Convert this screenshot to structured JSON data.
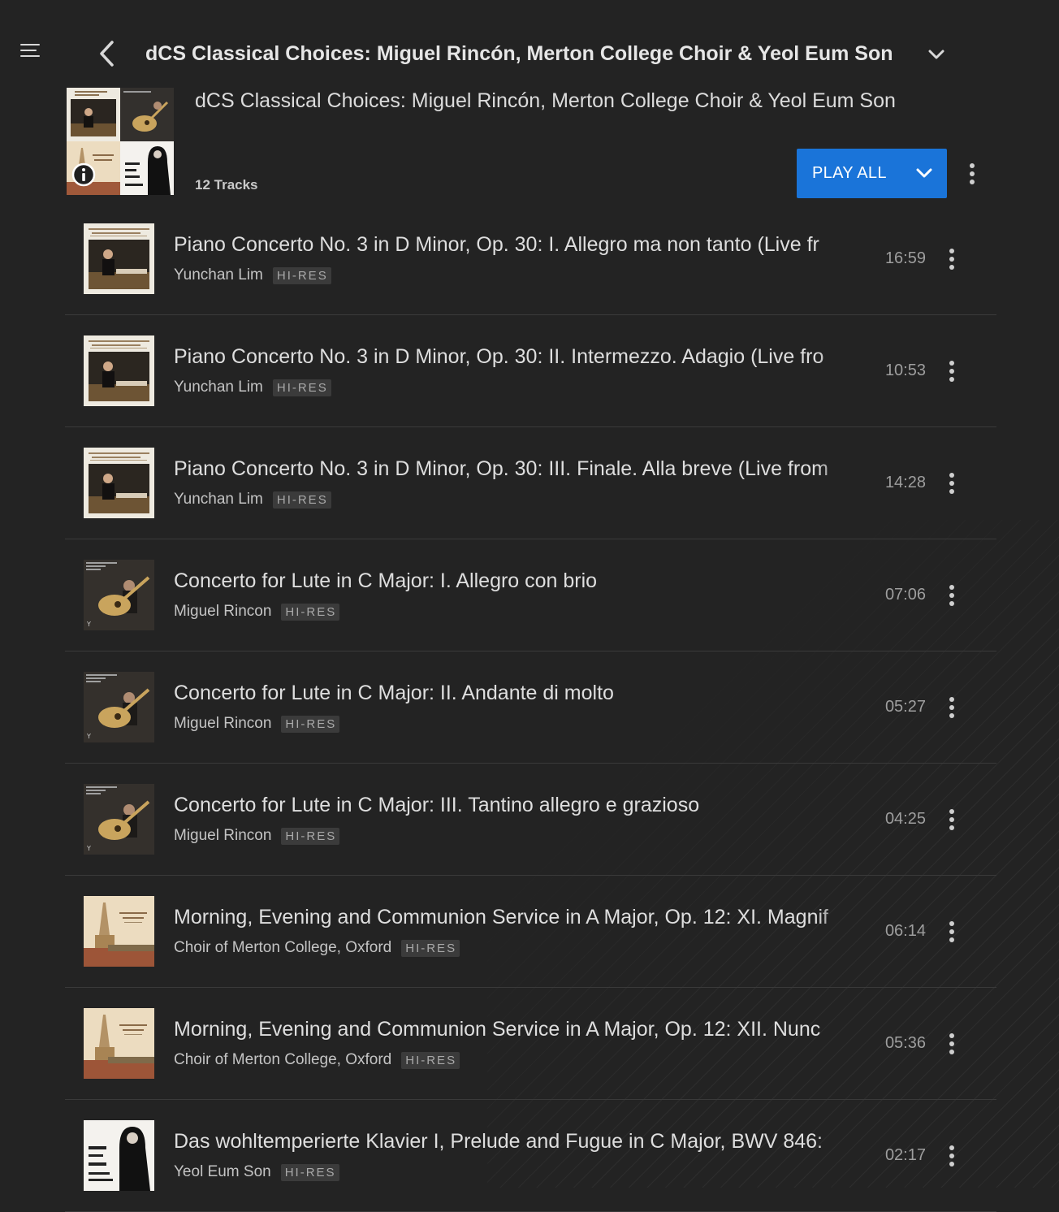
{
  "header": {
    "title": "dCS Classical Choices: Miguel Rincón, Merton College Choir & Yeol Eum Son"
  },
  "playlist": {
    "title": "dCS Classical Choices: Miguel Rincón, Merton College Choir & Yeol Eum Son",
    "track_count": "12 Tracks",
    "play_all_label": "PLAY ALL"
  },
  "colors": {
    "background": "#232323",
    "accent": "#1a74d9",
    "text": "#dedede",
    "muted": "#9e9e9e"
  },
  "tracks": [
    {
      "title": "Piano Concerto No. 3 in D Minor, Op. 30: I. Allegro ma non tanto (Live fr",
      "artist": "Yunchan Lim",
      "badge": "HI-RES",
      "duration": "16:59",
      "art": "piano"
    },
    {
      "title": "Piano Concerto No. 3 in D Minor, Op. 30: II. Intermezzo. Adagio (Live fro",
      "artist": "Yunchan Lim",
      "badge": "HI-RES",
      "duration": "10:53",
      "art": "piano"
    },
    {
      "title": "Piano Concerto No. 3 in D Minor, Op. 30: III. Finale. Alla breve (Live from",
      "artist": "Yunchan Lim",
      "badge": "HI-RES",
      "duration": "14:28",
      "art": "piano"
    },
    {
      "title": "Concerto for Lute in C Major: I. Allegro con brio",
      "artist": "Miguel Rincon",
      "badge": "HI-RES",
      "duration": "07:06",
      "art": "lute"
    },
    {
      "title": "Concerto for Lute in C Major: II. Andante di molto",
      "artist": "Miguel Rincon",
      "badge": "HI-RES",
      "duration": "05:27",
      "art": "lute"
    },
    {
      "title": "Concerto for Lute in C Major: III. Tantino allegro e grazioso",
      "artist": "Miguel Rincon",
      "badge": "HI-RES",
      "duration": "04:25",
      "art": "lute"
    },
    {
      "title": "Morning, Evening and Communion Service in A Major, Op. 12: XI. Magnif",
      "artist": "Choir of Merton College, Oxford",
      "badge": "HI-RES",
      "duration": "06:14",
      "art": "anthems"
    },
    {
      "title": "Morning, Evening and Communion Service in A Major, Op. 12: XII. Nunc",
      "artist": "Choir of Merton College, Oxford",
      "badge": "HI-RES",
      "duration": "05:36",
      "art": "anthems"
    },
    {
      "title": "Das wohltemperierte Klavier I, Prelude and Fugue in C Major, BWV 846:",
      "artist": "Yeol Eum Son",
      "badge": "HI-RES",
      "duration": "02:17",
      "art": "ravel"
    }
  ]
}
